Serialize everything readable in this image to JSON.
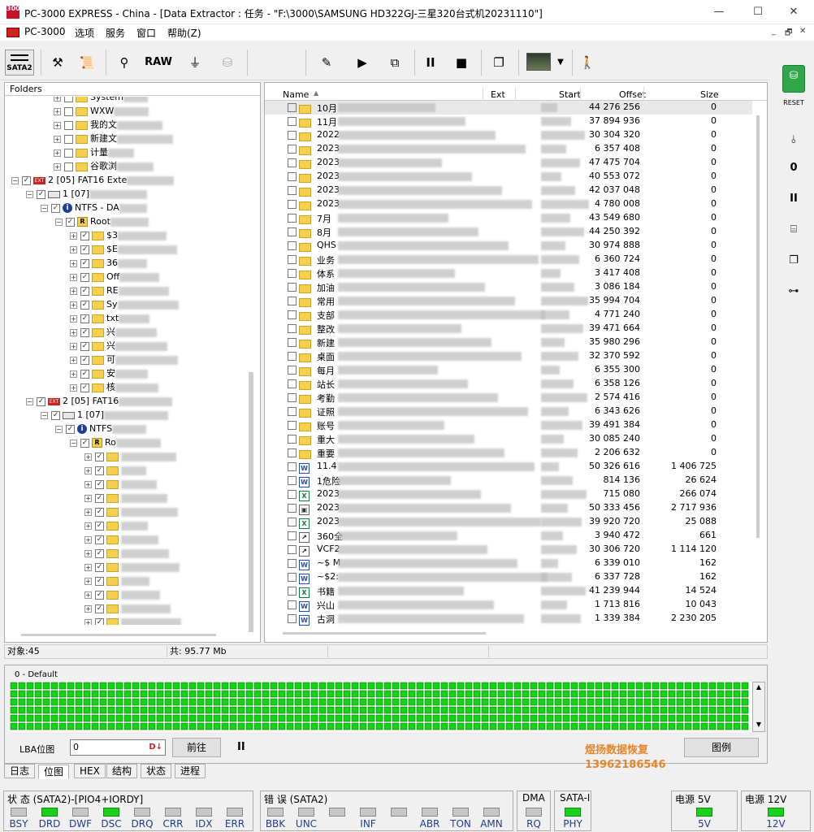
{
  "window": {
    "title": "PC-3000 EXPRESS - China - [Data Extractor : 任务 - \"F:\\3000\\SAMSUNG HD322GJ-三星320台式机20231110\"]",
    "app_icon_text": "3000",
    "minimize": "—",
    "maximize": "☐",
    "close": "✕"
  },
  "menubar": {
    "items": [
      "PC-3000",
      "选项",
      "服务",
      "窗口",
      "帮助(Z)"
    ],
    "mdi_controls": [
      "_",
      "🗗",
      "✕"
    ]
  },
  "toolbar": {
    "sata_label": "SATA2",
    "raw_label": "RAW"
  },
  "folders": {
    "header": "Folders",
    "rows": [
      {
        "indent": 52,
        "label": "System",
        "type": "folder"
      },
      {
        "indent": 52,
        "label": "WXW",
        "type": "folder"
      },
      {
        "indent": 52,
        "label": "我的文",
        "type": "folder"
      },
      {
        "indent": 52,
        "label": "新建文",
        "type": "folder"
      },
      {
        "indent": 52,
        "label": "计量",
        "type": "folder"
      },
      {
        "indent": 52,
        "label": "谷歌浏",
        "type": "folder"
      },
      {
        "indent": 0,
        "label": "2 [05] FAT16 Exte",
        "type": "part"
      },
      {
        "indent": 18,
        "label": "1 [07]",
        "type": "disk"
      },
      {
        "indent": 36,
        "label": "NTFS - DA",
        "type": "info"
      },
      {
        "indent": 54,
        "label": "Root",
        "type": "root"
      },
      {
        "indent": 72,
        "label": "$3",
        "type": "folder"
      },
      {
        "indent": 72,
        "label": "$E",
        "type": "folder"
      },
      {
        "indent": 72,
        "label": "36",
        "type": "folder"
      },
      {
        "indent": 72,
        "label": "Off",
        "type": "folder"
      },
      {
        "indent": 72,
        "label": "RE",
        "type": "folder"
      },
      {
        "indent": 72,
        "label": "Sy",
        "type": "folder"
      },
      {
        "indent": 72,
        "label": "txt",
        "type": "folder"
      },
      {
        "indent": 72,
        "label": "兴",
        "type": "folder"
      },
      {
        "indent": 72,
        "label": "兴",
        "type": "folder"
      },
      {
        "indent": 72,
        "label": "可",
        "type": "folder"
      },
      {
        "indent": 72,
        "label": "安",
        "type": "folder"
      },
      {
        "indent": 72,
        "label": "核",
        "type": "folder"
      },
      {
        "indent": 18,
        "label": "2 [05] FAT16",
        "type": "part"
      },
      {
        "indent": 36,
        "label": "1 [07]",
        "type": "disk"
      },
      {
        "indent": 54,
        "label": "NTFS",
        "type": "info"
      },
      {
        "indent": 72,
        "label": "Ro",
        "type": "root"
      },
      {
        "indent": 90,
        "label": "",
        "type": "folder"
      },
      {
        "indent": 90,
        "label": "",
        "type": "folder"
      },
      {
        "indent": 90,
        "label": "",
        "type": "folder"
      },
      {
        "indent": 90,
        "label": "",
        "type": "folder"
      },
      {
        "indent": 90,
        "label": "",
        "type": "folder"
      },
      {
        "indent": 90,
        "label": "",
        "type": "folder"
      },
      {
        "indent": 90,
        "label": "",
        "type": "folder"
      },
      {
        "indent": 90,
        "label": "",
        "type": "folder"
      },
      {
        "indent": 90,
        "label": "",
        "type": "folder"
      },
      {
        "indent": 90,
        "label": "",
        "type": "folder"
      },
      {
        "indent": 90,
        "label": "",
        "type": "folder"
      },
      {
        "indent": 90,
        "label": "",
        "type": "folder"
      },
      {
        "indent": 90,
        "label": "",
        "type": "folder"
      },
      {
        "indent": 90,
        "label": "",
        "type": "folder"
      }
    ]
  },
  "files": {
    "columns": {
      "name": "Name",
      "ext": "Ext",
      "start": "Start",
      "offset": "Offset",
      "size": "Size"
    },
    "rows": [
      {
        "name": "10月",
        "icon": "folder",
        "offset": "44 276 256",
        "size": "0"
      },
      {
        "name": "11月",
        "icon": "folder",
        "offset": "37 894 936",
        "size": "0"
      },
      {
        "name": "2022",
        "icon": "folder",
        "offset": "30 304 320",
        "size": "0"
      },
      {
        "name": "2023",
        "icon": "folder",
        "offset": "6 357 408",
        "size": "0"
      },
      {
        "name": "2023",
        "icon": "folder",
        "offset": "47 475 704",
        "size": "0"
      },
      {
        "name": "2023",
        "icon": "folder",
        "offset": "40 553 072",
        "size": "0"
      },
      {
        "name": "2023",
        "icon": "folder",
        "offset": "42 037 048",
        "size": "0"
      },
      {
        "name": "2023",
        "icon": "folder",
        "offset": "4 780 008",
        "size": "0"
      },
      {
        "name": "7月",
        "icon": "folder",
        "offset": "43 549 680",
        "size": "0"
      },
      {
        "name": "8月",
        "icon": "folder",
        "offset": "44 250 392",
        "size": "0"
      },
      {
        "name": "QHS",
        "icon": "folder",
        "offset": "30 974 888",
        "size": "0"
      },
      {
        "name": "业务",
        "icon": "folder",
        "offset": "6 360 724",
        "size": "0"
      },
      {
        "name": "体系",
        "icon": "folder",
        "offset": "3 417 408",
        "size": "0"
      },
      {
        "name": "加油",
        "icon": "folder",
        "offset": "3 086 184",
        "size": "0"
      },
      {
        "name": "常用",
        "icon": "folder",
        "offset": "35 994 704",
        "size": "0"
      },
      {
        "name": "支部",
        "icon": "folder",
        "offset": "4 771 240",
        "size": "0"
      },
      {
        "name": "整改",
        "icon": "folder",
        "offset": "39 471 664",
        "size": "0"
      },
      {
        "name": "新建",
        "icon": "folder",
        "offset": "35 980 296",
        "size": "0"
      },
      {
        "name": "桌面",
        "icon": "folder",
        "offset": "32 370 592",
        "size": "0"
      },
      {
        "name": "每月",
        "icon": "folder",
        "offset": "6 355 300",
        "size": "0"
      },
      {
        "name": "站长",
        "icon": "folder",
        "offset": "6 358 126",
        "size": "0"
      },
      {
        "name": "考勤",
        "icon": "folder",
        "offset": "2 574 416",
        "size": "0"
      },
      {
        "name": "证照",
        "icon": "folder",
        "offset": "6 343 626",
        "size": "0"
      },
      {
        "name": "账号",
        "icon": "folder",
        "offset": "39 491 384",
        "size": "0"
      },
      {
        "name": "重大",
        "icon": "folder",
        "offset": "30 085 240",
        "size": "0"
      },
      {
        "name": "重要",
        "icon": "folder",
        "offset": "2 206 632",
        "size": "0"
      },
      {
        "name": "11.4",
        "icon": "w",
        "offset": "50 326 616",
        "size": "1 406 725"
      },
      {
        "name": "1危险",
        "icon": "w",
        "offset": "814 136",
        "size": "26 624"
      },
      {
        "name": "2023",
        "icon": "x",
        "offset": "715 080",
        "size": "266 074"
      },
      {
        "name": "2023",
        "icon": "p",
        "offset": "50 333 456",
        "size": "2 717 936"
      },
      {
        "name": "2023",
        "icon": "x",
        "offset": "39 920 720",
        "size": "25 088"
      },
      {
        "name": "360全",
        "icon": "g",
        "offset": "3 940 472",
        "size": "661"
      },
      {
        "name": "VCF2",
        "icon": "g",
        "offset": "30 306 720",
        "size": "1 114 120"
      },
      {
        "name": "~$ M",
        "icon": "w",
        "offset": "6 339 010",
        "size": "162"
      },
      {
        "name": "~$2:",
        "icon": "w",
        "offset": "6 337 728",
        "size": "162"
      },
      {
        "name": "书籍",
        "icon": "x",
        "offset": "41 239 944",
        "size": "14 524"
      },
      {
        "name": "兴山",
        "icon": "w",
        "offset": "1 713 816",
        "size": "10 043"
      },
      {
        "name": "古洞",
        "icon": "w",
        "offset": "1 339 384",
        "size": "2 230 205"
      }
    ]
  },
  "status": {
    "objects": "对象:45",
    "total": "共: 95.77 Mb"
  },
  "map": {
    "title": "0 - Default",
    "lba_label": "LBA位图",
    "lba_value": "0",
    "goto_button": "前往",
    "pause_button": "II",
    "legend_button": "图例",
    "watermark_line1": "煜扬数据恢复",
    "watermark_line2": "13962186546"
  },
  "tabs": [
    "日志",
    "位图",
    "HEX",
    "结构",
    "状态",
    "进程"
  ],
  "bottom": {
    "status_group_title": "状 态 (SATA2)-[PIO4+IORDY]",
    "error_group_title": "错 误 (SATA2)",
    "dma_title": "DMA",
    "sata_title": "SATA-I",
    "power5_title": "电源 5V",
    "power12_title": "电源 12V",
    "status_leds": [
      {
        "label": "BSY",
        "on": false
      },
      {
        "label": "DRD",
        "on": true
      },
      {
        "label": "DWF",
        "on": false
      },
      {
        "label": "DSC",
        "on": true
      },
      {
        "label": "DRQ",
        "on": false
      },
      {
        "label": "CRR",
        "on": false
      },
      {
        "label": "IDX",
        "on": false
      },
      {
        "label": "ERR",
        "on": false
      }
    ],
    "error_leds": [
      {
        "label": "BBK",
        "on": false
      },
      {
        "label": "UNC",
        "on": false
      },
      {
        "label": "",
        "on": false
      },
      {
        "label": "INF",
        "on": false
      },
      {
        "label": "",
        "on": false
      },
      {
        "label": "ABR",
        "on": false
      },
      {
        "label": "TON",
        "on": false
      },
      {
        "label": "AMN",
        "on": false
      }
    ],
    "dma_led": {
      "label": "RQ",
      "on": false
    },
    "sata_led": {
      "label": "PHY",
      "on": true
    },
    "power5_led": {
      "label": "5V",
      "on": true
    },
    "power12_led": {
      "label": "12V",
      "on": true
    }
  }
}
